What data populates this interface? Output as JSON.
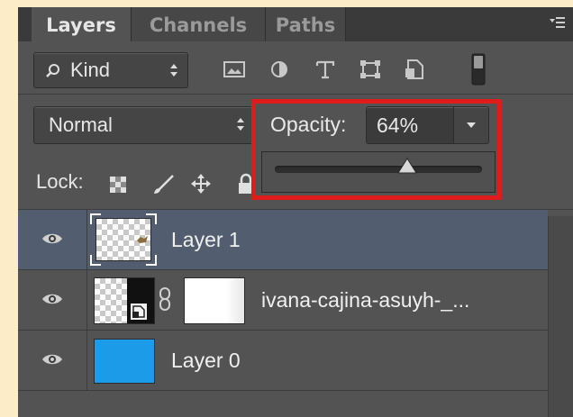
{
  "tabs": [
    {
      "label": "Layers",
      "active": true
    },
    {
      "label": "Channels",
      "active": false
    },
    {
      "label": "Paths",
      "active": false
    }
  ],
  "filter": {
    "label": "Kind",
    "icons": [
      "image-filter-icon",
      "adjustment-filter-icon",
      "type-filter-icon",
      "shape-filter-icon",
      "smart-object-filter-icon",
      "filter-toggle-icon"
    ]
  },
  "blend_mode": {
    "value": "Normal"
  },
  "opacity": {
    "label": "Opacity:",
    "value": "64%",
    "level": 0.64
  },
  "lock": {
    "label": "Lock:"
  },
  "layers": [
    {
      "name": "Layer 1",
      "selected": true,
      "visible": true
    },
    {
      "name": "ivana-cajina-asuyh-_...",
      "selected": false,
      "visible": true
    },
    {
      "name": "Layer 0",
      "selected": false,
      "visible": true,
      "color": "#1c9ce8"
    }
  ],
  "colors": {
    "highlight": "#e01b1b",
    "selection": "#525d6f",
    "panel": "#535353",
    "layer0_fill": "#1c9ce8"
  }
}
